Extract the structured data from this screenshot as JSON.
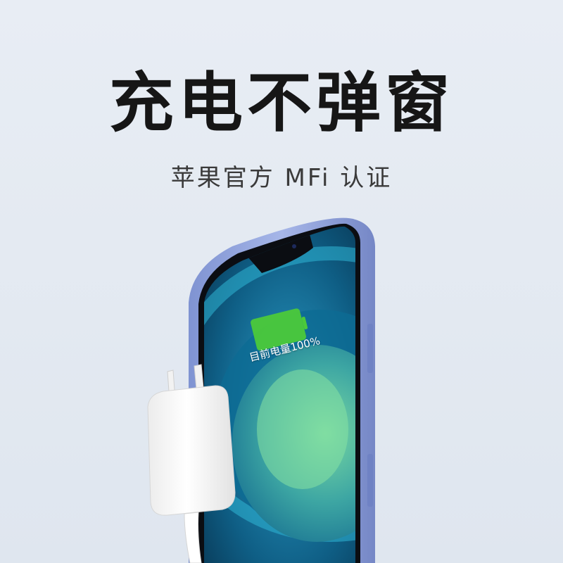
{
  "headline": "充电不弹窗",
  "subhead": "苹果官方 MFi 认证",
  "screen": {
    "battery_label": "目前电量100%",
    "battery_level": 1.0
  },
  "colors": {
    "background": "#e4eaf2",
    "headline": "#161616",
    "phone_frame": "#8fa3dc",
    "battery_fill": "#4cc93a"
  }
}
